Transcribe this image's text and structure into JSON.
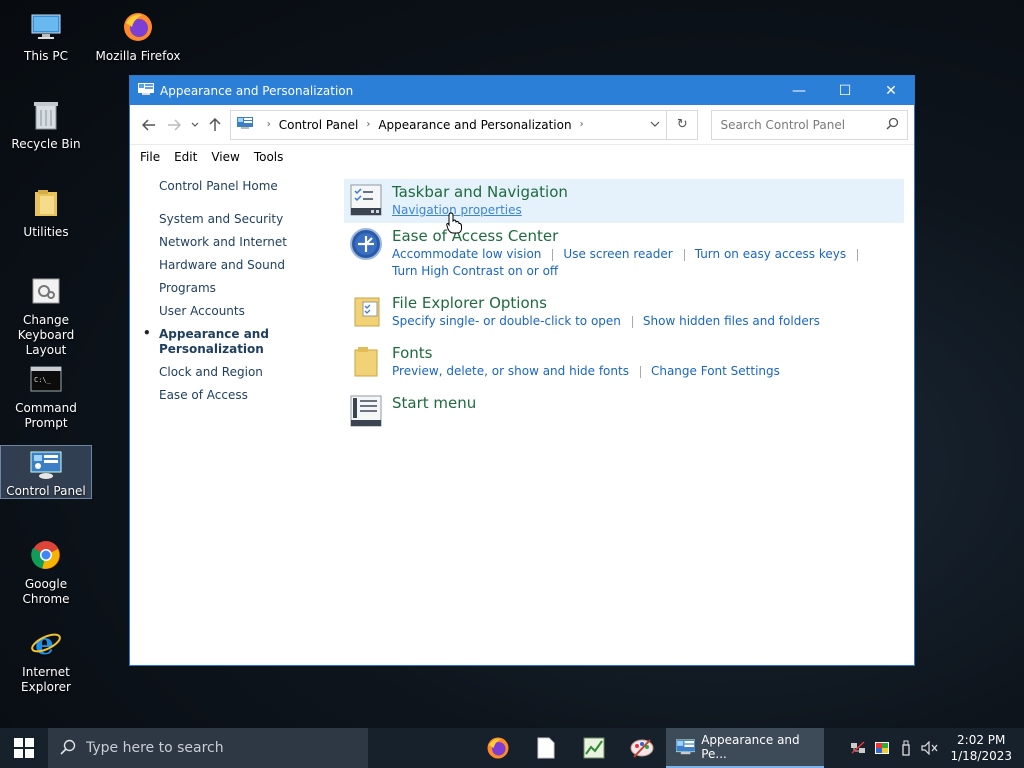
{
  "desktop": {
    "icons": [
      {
        "label": "This PC"
      },
      {
        "label": "Mozilla Firefox"
      },
      {
        "label": "Recycle Bin"
      },
      {
        "label": "Utilities"
      },
      {
        "label": "Change Keyboard Layout"
      },
      {
        "label": "Command Prompt"
      },
      {
        "label": "Control Panel"
      },
      {
        "label": "Google Chrome"
      },
      {
        "label": "Internet Explorer"
      }
    ]
  },
  "window": {
    "title": "Appearance and Personalization",
    "controls": {
      "minimize": "—",
      "maximize": "☐",
      "close": "✕"
    },
    "breadcrumb": [
      "Control Panel",
      "Appearance and Personalization"
    ],
    "search_placeholder": "Search Control Panel",
    "menu": [
      "File",
      "Edit",
      "View",
      "Tools"
    ],
    "leftnav": {
      "home": "Control Panel Home",
      "items": [
        "System and Security",
        "Network and Internet",
        "Hardware and Sound",
        "Programs",
        "User Accounts"
      ],
      "current": "Appearance and Personalization",
      "after": [
        "Clock and Region",
        "Ease of Access"
      ]
    },
    "categories": [
      {
        "title": "Taskbar and Navigation",
        "links": [
          "Navigation properties"
        ]
      },
      {
        "title": "Ease of Access Center",
        "links": [
          "Accommodate low vision",
          "Use screen reader",
          "Turn on easy access keys",
          "Turn High Contrast on or off"
        ]
      },
      {
        "title": "File Explorer Options",
        "links": [
          "Specify single- or double-click to open",
          "Show hidden files and folders"
        ]
      },
      {
        "title": "Fonts",
        "links": [
          "Preview, delete, or show and hide fonts",
          "Change Font Settings"
        ]
      },
      {
        "title": "Start menu",
        "links": []
      }
    ]
  },
  "taskbar": {
    "search_placeholder": "Type here to search",
    "active_window": "Appearance and Pe...",
    "time": "2:02 PM",
    "date": "1/18/2023"
  }
}
